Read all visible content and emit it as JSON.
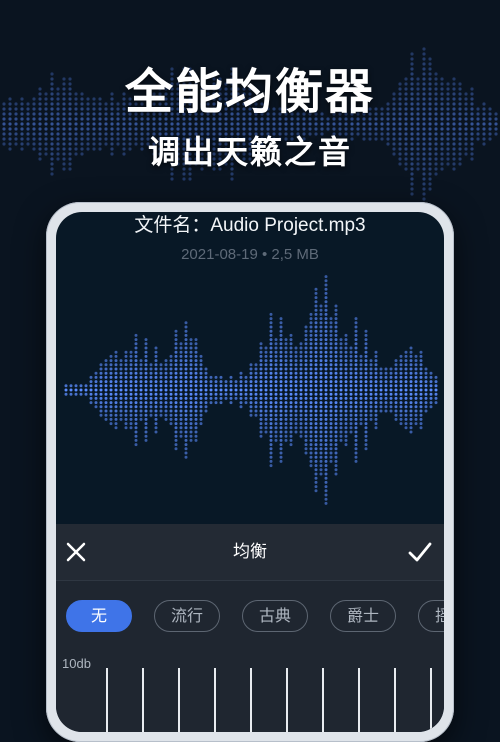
{
  "promo": {
    "headline": "全能均衡器",
    "subheadline": "调出天籁之音"
  },
  "file": {
    "title": "文件名：Audio Project.mp3",
    "meta": "2021-08-19 • 2,5 MB"
  },
  "equalizer": {
    "title": "均衡",
    "close_icon": "close-icon",
    "confirm_icon": "check-icon",
    "presets": [
      {
        "label": "无",
        "active": true
      },
      {
        "label": "流行",
        "active": false
      },
      {
        "label": "古典",
        "active": false
      },
      {
        "label": "爵士",
        "active": false
      },
      {
        "label": "摇滚",
        "active": false
      }
    ],
    "db_label": "10db",
    "band_count": 10
  },
  "colors": {
    "accent": "#3f74e8",
    "wave": "#5b8cff",
    "background": "#0a1420",
    "panel": "#1f2630"
  }
}
